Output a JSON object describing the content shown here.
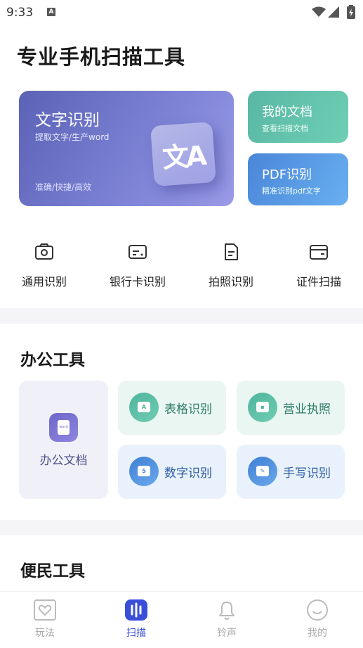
{
  "status": {
    "time": "9:33",
    "notif_icon": "A"
  },
  "title": "专业手机扫描工具",
  "hero": {
    "title": "文字识别",
    "subtitle": "提取文字/生产word",
    "tagline": "准确/快捷/高效",
    "badge": "文A"
  },
  "side_cards": {
    "docs": {
      "title": "我的文档",
      "subtitle": "查看扫描文档"
    },
    "pdf": {
      "title": "PDF识别",
      "subtitle": "精准识别pdf文字"
    }
  },
  "quick": [
    {
      "label": "通用识别",
      "icon": "camera-icon"
    },
    {
      "label": "银行卡识别",
      "icon": "bank-card-icon"
    },
    {
      "label": "拍照识别",
      "icon": "document-icon"
    },
    {
      "label": "证件扫描",
      "icon": "wallet-icon"
    }
  ],
  "office": {
    "title": "办公工具",
    "doc": {
      "label": "办公文档",
      "icon_text": "word"
    },
    "tiles": [
      {
        "label": "表格识别",
        "glyph": "A"
      },
      {
        "label": "营业执照",
        "glyph": "▪"
      },
      {
        "label": "数字识别",
        "glyph": "5"
      },
      {
        "label": "手写识别",
        "glyph": "✎"
      }
    ]
  },
  "civil": {
    "title": "便民工具"
  },
  "tabs": [
    {
      "label": "玩法",
      "icon": "heart-frame-icon"
    },
    {
      "label": "扫描",
      "icon": "scan-icon"
    },
    {
      "label": "铃声",
      "icon": "bell-icon"
    },
    {
      "label": "我的",
      "icon": "smile-icon"
    }
  ],
  "colors": {
    "accent": "#3a4fd8",
    "hero": "#6a6fc6",
    "green": "#59b7a4",
    "blue": "#4a86d8"
  }
}
